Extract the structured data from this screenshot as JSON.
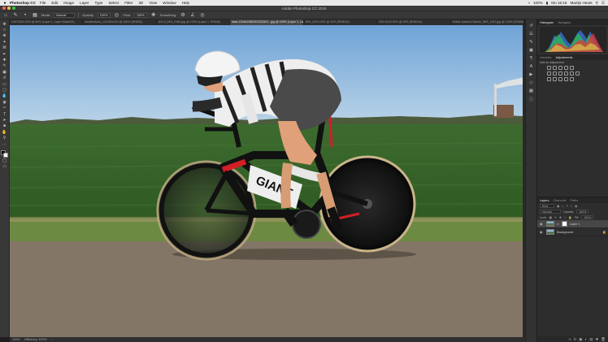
{
  "menubar": {
    "apple": "",
    "app_name": "Photoshop CC",
    "items": [
      "File",
      "Edit",
      "Image",
      "Layer",
      "Type",
      "Select",
      "Filter",
      "3D",
      "View",
      "Window",
      "Help"
    ],
    "battery": "100%",
    "clock": "Mo 16:15",
    "user": "Martijn Heuts"
  },
  "window": {
    "title": "Adobe Photoshop CC 2019"
  },
  "options": {
    "mode_label": "Mode:",
    "mode_value": "Normal",
    "opacity_label": "Opacity:",
    "opacity_value": "100%",
    "flow_label": "Flow:",
    "flow_value": "100%",
    "smoothing_label": "Smoothing:"
  },
  "tabs": [
    {
      "label": "DSC0262.CR2 @ 50% (Layer 1, Layer Mask/16)"
    },
    {
      "label": "shutterstock_1414531310 @ 100% (RGB/8)"
    },
    {
      "label": "AYL5_IMG_0165.jpg @ 100% (Layer 1, RGB/8)"
    },
    {
      "label": "data-120x612881f01333301...jpg @ 100% (Layer 1, Layer Mask/8)",
      "active": true
    },
    {
      "label": "IMG_0013.CR2 @ 33% (RGB/16)"
    },
    {
      "label": "DSC4193.CR2 @ 25% (RGB/16)"
    },
    {
      "label": "Wilder-tracked-Yatzee_IMG_1187.jpg @ 100% (RGB/8)"
    }
  ],
  "tools": [
    "move",
    "marquee",
    "lasso",
    "quick-select",
    "crop",
    "eyedropper",
    "healing",
    "brush",
    "clone-stamp",
    "history-brush",
    "eraser",
    "gradient",
    "blur",
    "dodge",
    "pen",
    "type",
    "path-select",
    "rectangle",
    "hand",
    "zoom",
    "more"
  ],
  "status": {
    "zoom": "100%",
    "info": "Efficiency: 100%*"
  },
  "right_panel": {
    "histogram_tabs": [
      "Histogram",
      "Navigator"
    ],
    "adjust_tabs": [
      "Libraries",
      "Adjustments"
    ],
    "add_adjustment": "Add an adjustment",
    "layer_tabs": [
      "Layers",
      "Channels",
      "Paths"
    ],
    "kind_label": "Kind",
    "blend_mode": "Normal",
    "opacity_label": "Opacity:",
    "opacity_value": "100%",
    "lock_label": "Lock:",
    "fill_label": "Fill:",
    "fill_value": "100%",
    "layers": [
      {
        "name": "Layer 1",
        "selected": true,
        "mask": true
      },
      {
        "name": "Background",
        "selected": false,
        "mask": false
      }
    ]
  },
  "colors": {
    "menubar": "#e9e9e9",
    "ui_dark": "#383838",
    "panel": "#2d2d2d",
    "close": "#fc605c",
    "minimize": "#fdbc40",
    "zoom": "#34c84a"
  }
}
